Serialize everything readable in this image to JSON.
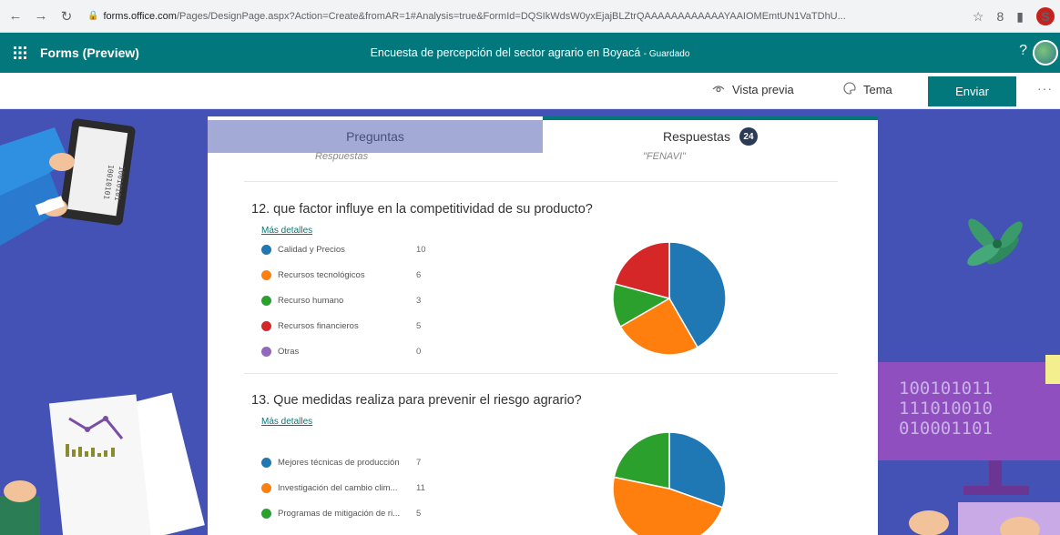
{
  "browser": {
    "url_domain": "forms.office.com",
    "url_path": "/Pages/DesignPage.aspx?Action=Create&fromAR=1#Analysis=true&FormId=DQSIkWdsW0yxEjajBLZtrQAAAAAAAAAAAAYAAIOMEmtUN1VaTDhU...",
    "profile_initial": "S"
  },
  "header": {
    "app_name": "Forms (Preview)",
    "form_title": "Encuesta de percepción del sector agrario en Boyacá",
    "save_status": "- Guardado",
    "help": "?"
  },
  "toolbar": {
    "preview_label": "Vista previa",
    "theme_label": "Tema",
    "send_label": "Enviar",
    "more_label": "···"
  },
  "tabs": {
    "questions_label": "Preguntas",
    "responses_label": "Respuestas",
    "responses_count": "24"
  },
  "previous_question": {
    "cut_left": "Respuestas",
    "cut_right": "\"FENAVI\""
  },
  "questions": [
    {
      "title": "12.  que factor influye en la competitividad de su producto?",
      "more_details": "Más detalles",
      "options": [
        {
          "label": "Calidad y Precios",
          "count": 10,
          "color": "#1f77b4"
        },
        {
          "label": "Recursos tecnológicos",
          "count": 6,
          "color": "#ff7f0e"
        },
        {
          "label": "Recurso humano",
          "count": 3,
          "color": "#2ca02c"
        },
        {
          "label": "Recursos financieros",
          "count": 5,
          "color": "#d62728"
        },
        {
          "label": "Otras",
          "count": 0,
          "color": "#9467bd"
        }
      ]
    },
    {
      "title": "13.  Que medidas realiza para prevenir el riesgo agrario?",
      "more_details": "Más detalles",
      "options": [
        {
          "label": "Mejores técnicas de producción",
          "count": 7,
          "color": "#1f77b4"
        },
        {
          "label": "Investigación del cambio clim...",
          "count": 11,
          "color": "#ff7f0e"
        },
        {
          "label": "Programas de mitigación de ri...",
          "count": 5,
          "color": "#2ca02c"
        }
      ]
    }
  ],
  "chart_data": [
    {
      "type": "pie",
      "categories": [
        "Calidad y Precios",
        "Recursos tecnológicos",
        "Recurso humano",
        "Recursos financieros",
        "Otras"
      ],
      "values": [
        10,
        6,
        3,
        5,
        0
      ],
      "colors": [
        "#1f77b4",
        "#ff7f0e",
        "#2ca02c",
        "#d62728",
        "#9467bd"
      ]
    },
    {
      "type": "pie",
      "categories": [
        "Mejores técnicas de producción",
        "Investigación del cambio clim...",
        "Programas de mitigación de ri..."
      ],
      "values": [
        7,
        11,
        5
      ],
      "colors": [
        "#1f77b4",
        "#ff7f0e",
        "#2ca02c"
      ]
    }
  ],
  "art": {
    "binary_lines": [
      "100101011",
      "111010010",
      "010001101"
    ]
  }
}
